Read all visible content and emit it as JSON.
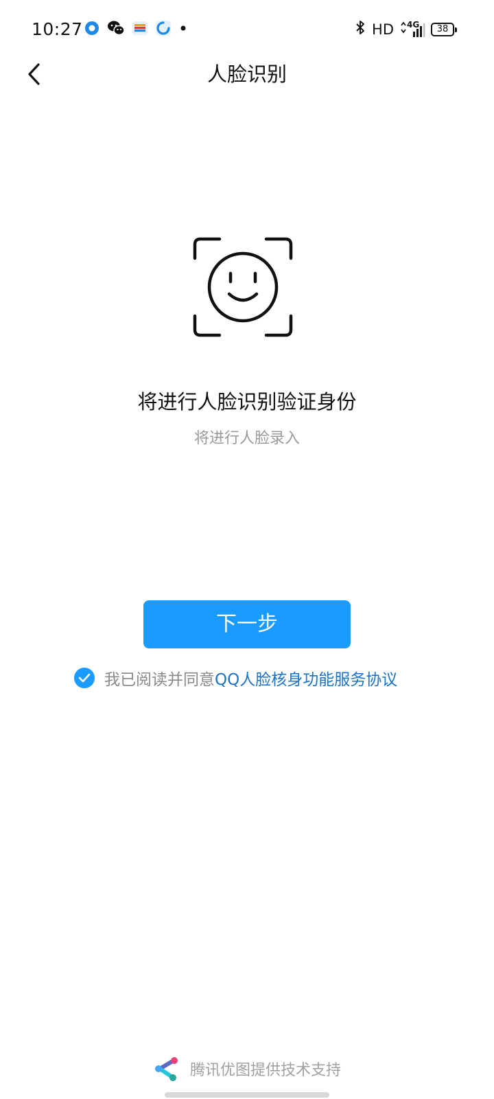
{
  "status_bar": {
    "time": "10:27",
    "notification_icons": [
      "app-ring-icon",
      "wechat-icon",
      "wallet-icon",
      "browser-icon",
      "more-dot-icon"
    ],
    "hd_label": "HD",
    "network_label": "4G",
    "battery_level": "38"
  },
  "nav": {
    "back_icon": "chevron-left-icon",
    "title": "人脸识别"
  },
  "main": {
    "face_icon": "face-scan-icon",
    "headline": "将进行人脸识别验证身份",
    "subline": "将进行人脸录入",
    "next_button_label": "下一步"
  },
  "agreement": {
    "checked": true,
    "prefix": "我已阅读并同意",
    "link_text": "QQ人脸核身功能服务协议"
  },
  "footer": {
    "logo_icon": "youtu-logo-icon",
    "text": "腾讯优图提供技术支持"
  },
  "colors": {
    "accent": "#1a9bff",
    "link": "#1a73c9",
    "muted_text": "#9a9a9a"
  }
}
